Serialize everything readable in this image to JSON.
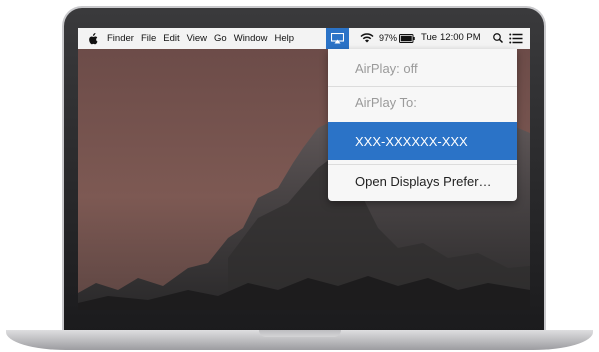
{
  "menubar": {
    "apple_icon": "apple-logo-icon",
    "items": [
      "Finder",
      "File",
      "Edit",
      "View",
      "Go",
      "Window",
      "Help"
    ],
    "battery_percent": "97%",
    "day": "Tue",
    "time": "12:00 PM",
    "status_icons": [
      "airplay-icon",
      "wifi-icon",
      "battery-icon",
      "spotlight-search-icon",
      "notification-list-icon"
    ]
  },
  "airplay_menu": {
    "status": "AirPlay: off",
    "header": "AirPlay To:",
    "device": "XXX-XXXXXX-XXX",
    "open_prefs": "Open Displays Prefer…"
  },
  "colors": {
    "accent": "#2b73c7",
    "menubar_bg": "#f3f3f3",
    "menu_bg": "#f7f7f7"
  }
}
